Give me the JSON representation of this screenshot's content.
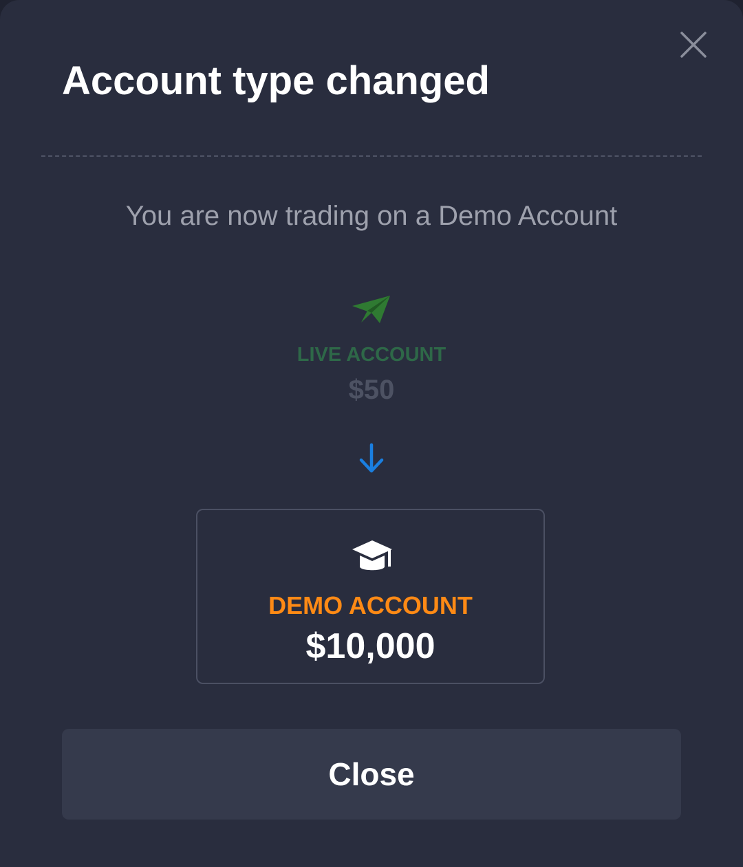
{
  "modal": {
    "title": "Account type changed",
    "subtitle": "You are now trading on a Demo Account",
    "close_icon": "close-icon"
  },
  "from_account": {
    "icon": "paper-plane-icon",
    "label": "LIVE ACCOUNT",
    "amount": "$50",
    "label_color": "#2e6848"
  },
  "transition": {
    "icon": "arrow-down-icon",
    "color": "#1a7fe0"
  },
  "to_account": {
    "icon": "graduation-cap-icon",
    "label": "DEMO ACCOUNT",
    "amount": "$10,000",
    "label_color": "#ff8a15"
  },
  "actions": {
    "close_label": "Close"
  }
}
